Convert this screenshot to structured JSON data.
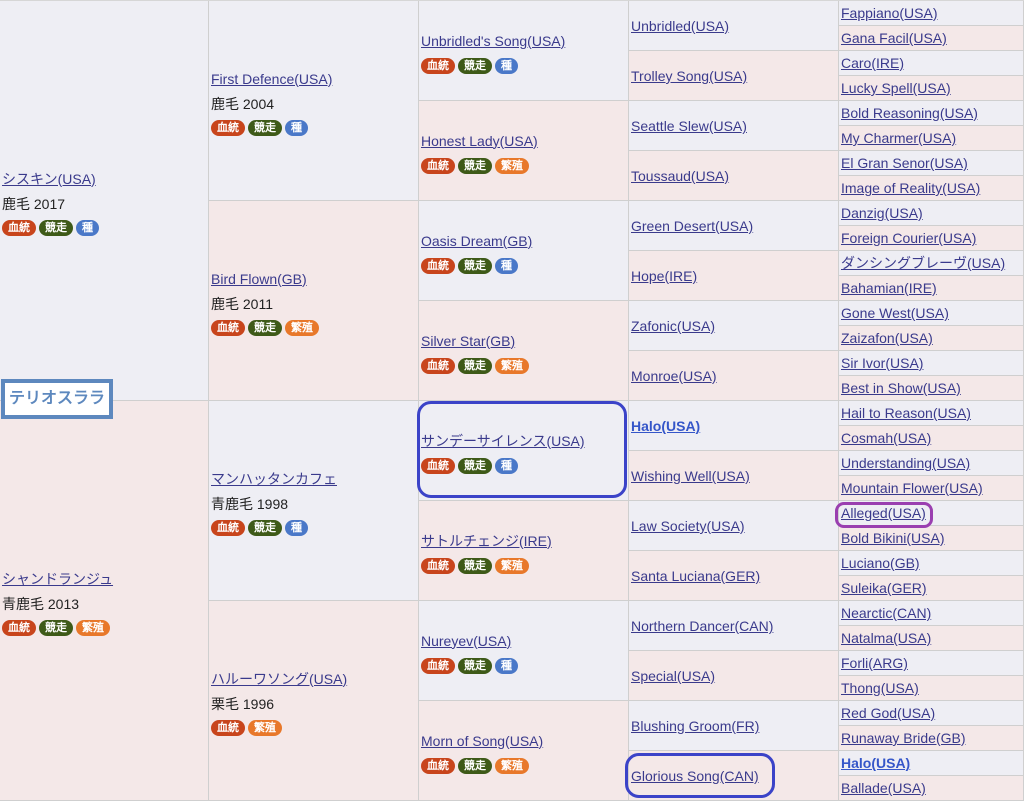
{
  "subject": "テリオスララ",
  "badge_labels": {
    "blood": "血統",
    "race": "競走",
    "stud": "種",
    "breed": "繁殖"
  },
  "gen1": [
    {
      "name": "シスキン(USA)",
      "info": "鹿毛 2017",
      "badges": [
        "blood",
        "race",
        "stud"
      ]
    },
    {
      "name": "シャンドランジュ",
      "info": "青鹿毛 2013",
      "badges": [
        "blood",
        "race",
        "breed"
      ]
    }
  ],
  "gen2": [
    {
      "name": "First Defence(USA)",
      "info": "鹿毛 2004",
      "badges": [
        "blood",
        "race",
        "stud"
      ]
    },
    {
      "name": "Bird Flown(GB)",
      "info": "鹿毛 2011",
      "badges": [
        "blood",
        "race",
        "breed"
      ]
    },
    {
      "name": "マンハッタンカフェ",
      "info": "青鹿毛 1998",
      "badges": [
        "blood",
        "race",
        "stud"
      ]
    },
    {
      "name": "ハルーワソング(USA)",
      "info": "栗毛 1996",
      "badges": [
        "blood",
        "breed"
      ]
    }
  ],
  "gen3": [
    {
      "name": "Unbridled's Song(USA)",
      "badges": [
        "blood",
        "race",
        "stud"
      ]
    },
    {
      "name": "Honest Lady(USA)",
      "badges": [
        "blood",
        "race",
        "breed"
      ]
    },
    {
      "name": "Oasis Dream(GB)",
      "badges": [
        "blood",
        "race",
        "stud"
      ]
    },
    {
      "name": "Silver Star(GB)",
      "badges": [
        "blood",
        "race",
        "breed"
      ]
    },
    {
      "name": "サンデーサイレンス(USA)",
      "badges": [
        "blood",
        "race",
        "stud"
      ]
    },
    {
      "name": "サトルチェンジ(IRE)",
      "badges": [
        "blood",
        "race",
        "breed"
      ]
    },
    {
      "name": "Nureyev(USA)",
      "badges": [
        "blood",
        "race",
        "stud"
      ]
    },
    {
      "name": "Morn of Song(USA)",
      "badges": [
        "blood",
        "race",
        "breed"
      ]
    }
  ],
  "gen4": [
    {
      "name": "Unbridled(USA)"
    },
    {
      "name": "Trolley Song(USA)"
    },
    {
      "name": "Seattle Slew(USA)"
    },
    {
      "name": "Toussaud(USA)"
    },
    {
      "name": "Green Desert(USA)"
    },
    {
      "name": "Hope(IRE)"
    },
    {
      "name": "Zafonic(USA)"
    },
    {
      "name": "Monroe(USA)"
    },
    {
      "name": "Halo(USA)",
      "bold": true
    },
    {
      "name": "Wishing Well(USA)"
    },
    {
      "name": "Law Society(USA)"
    },
    {
      "name": "Santa Luciana(GER)"
    },
    {
      "name": "Northern Dancer(CAN)"
    },
    {
      "name": "Special(USA)"
    },
    {
      "name": "Blushing Groom(FR)"
    },
    {
      "name": "Glorious Song(CAN)"
    }
  ],
  "gen5": [
    {
      "name": "Fappiano(USA)"
    },
    {
      "name": "Gana Facil(USA)"
    },
    {
      "name": "Caro(IRE)"
    },
    {
      "name": "Lucky Spell(USA)"
    },
    {
      "name": "Bold Reasoning(USA)"
    },
    {
      "name": "My Charmer(USA)"
    },
    {
      "name": "El Gran Senor(USA)"
    },
    {
      "name": "Image of Reality(USA)"
    },
    {
      "name": "Danzig(USA)"
    },
    {
      "name": "Foreign Courier(USA)"
    },
    {
      "name": "ダンシングブレーヴ(USA)"
    },
    {
      "name": "Bahamian(IRE)"
    },
    {
      "name": "Gone West(USA)"
    },
    {
      "name": "Zaizafon(USA)"
    },
    {
      "name": "Sir Ivor(USA)"
    },
    {
      "name": "Best in Show(USA)"
    },
    {
      "name": "Hail to Reason(USA)"
    },
    {
      "name": "Cosmah(USA)"
    },
    {
      "name": "Understanding(USA)"
    },
    {
      "name": "Mountain Flower(USA)"
    },
    {
      "name": "Alleged(USA)"
    },
    {
      "name": "Bold Bikini(USA)"
    },
    {
      "name": "Luciano(GB)"
    },
    {
      "name": "Suleika(GER)"
    },
    {
      "name": "Nearctic(CAN)"
    },
    {
      "name": "Natalma(USA)"
    },
    {
      "name": "Forli(ARG)"
    },
    {
      "name": "Thong(USA)"
    },
    {
      "name": "Red God(USA)"
    },
    {
      "name": "Runaway Bride(GB)"
    },
    {
      "name": "Halo(USA)",
      "bold": true
    },
    {
      "name": "Ballade(USA)"
    }
  ],
  "colors": {
    "highlight_blue": "#3b43c8",
    "highlight_purple": "#9a3fb0",
    "subject_border": "#5d88be"
  }
}
